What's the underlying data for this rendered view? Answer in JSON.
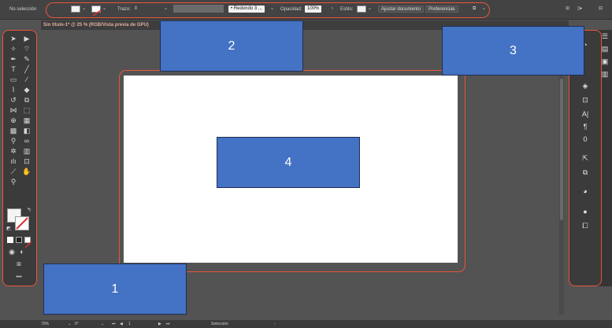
{
  "topbar": {
    "selection_label": "No selección",
    "stroke_label": "Trazo:",
    "brush_label": "Redondo 3 ...",
    "opacity_label": "Opacidad:",
    "opacity_value": "100%",
    "style_label": "Estilo:",
    "adjust_document_label": "Ajustar documento",
    "preferences_label": "Preferencias"
  },
  "document": {
    "tab_title": "Sin título-1* @ 25 % (RGB/Vista previa de GPU)"
  },
  "statusbar": {
    "zoom": "70%",
    "rotation": "0°",
    "page_number": "1",
    "mode": "Selección"
  },
  "callouts": [
    {
      "label": "1"
    },
    {
      "label": "2"
    },
    {
      "label": "3"
    },
    {
      "label": "4"
    }
  ],
  "colors": {
    "highlight_ring": "#e8553a",
    "callout_blue": "#4472c4"
  }
}
